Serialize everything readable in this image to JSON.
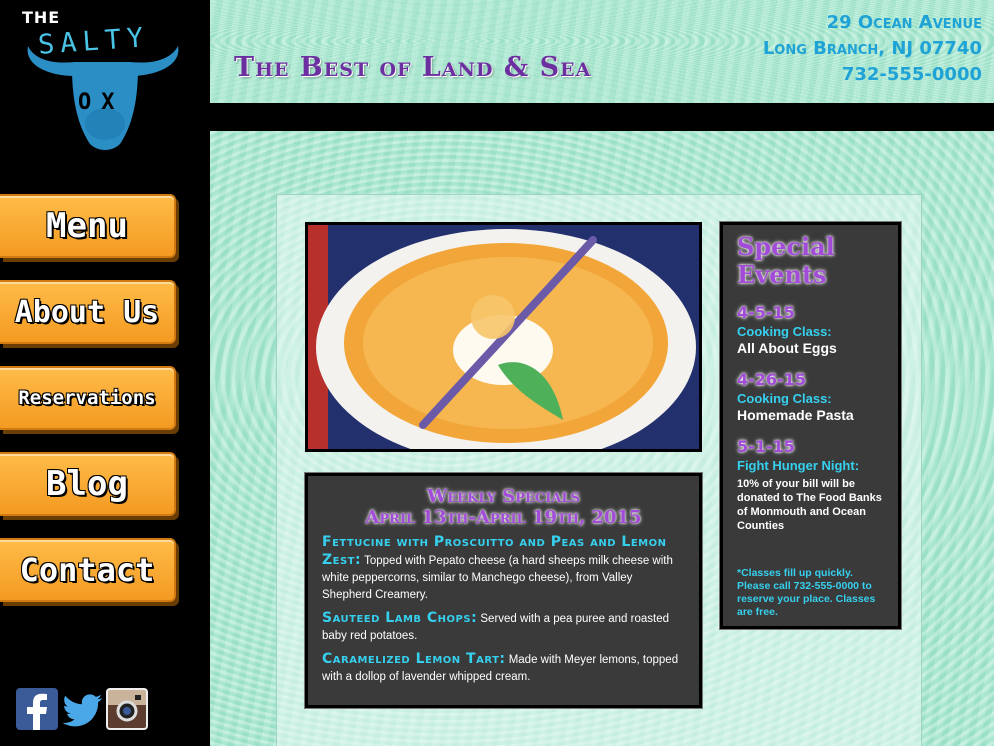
{
  "brand": {
    "logo_the": "THE",
    "logo_salty": "SALTY",
    "logo_ox": "OX"
  },
  "nav": {
    "menu": "Menu",
    "about": "About Us",
    "reservations": "Reservations",
    "blog": "Blog",
    "contact": "Contact"
  },
  "header": {
    "tagline": "The Best of Land & Sea",
    "address_line1": "29 Ocean Avenue",
    "address_line2": "Long Branch, NJ 07740",
    "phone": "732-555-0000"
  },
  "weekly_specials": {
    "title": "Weekly Specials",
    "dates": "April 13th-April 19th, 2015",
    "items": [
      {
        "name": "Fettucine with Proscuitto and Peas and Lemon Zest:",
        "desc": "Topped with Pepato cheese (a hard sheeps milk cheese with white peppercorns, similar to Manchego cheese), from Valley Shepherd Creamery."
      },
      {
        "name": "Sauteed Lamb Chops:",
        "desc": "Served with a pea puree and roasted baby red potatoes."
      },
      {
        "name": "Caramelized Lemon Tart:",
        "desc": "Made with Meyer lemons, topped with a dollop of lavender whipped cream."
      }
    ]
  },
  "events": {
    "title_line1": "Special",
    "title_line2": "Events",
    "items": [
      {
        "date": "4-5-15",
        "type": "Cooking Class:",
        "desc": "All About Eggs"
      },
      {
        "date": "4-26-15",
        "type": "Cooking Class:",
        "desc": "Homemade Pasta"
      },
      {
        "date": "5-1-15",
        "type": "Fight Hunger Night:",
        "desc": "10% of your bill will be donated to The Food Banks of Monmouth and Ocean Counties"
      }
    ],
    "note": "*Classes fill up quickly. Please call 732-555-0000 to reserve your place. Classes are free."
  },
  "social": {
    "facebook_icon": "facebook-icon",
    "twitter_icon": "twitter-icon",
    "instagram_icon": "instagram-icon"
  },
  "colors": {
    "mint": "#a6e8cf",
    "orange": "#f8a42e",
    "purple": "#a24bd8",
    "teal": "#36d0ef",
    "dark_box": "#3a3a3a"
  }
}
